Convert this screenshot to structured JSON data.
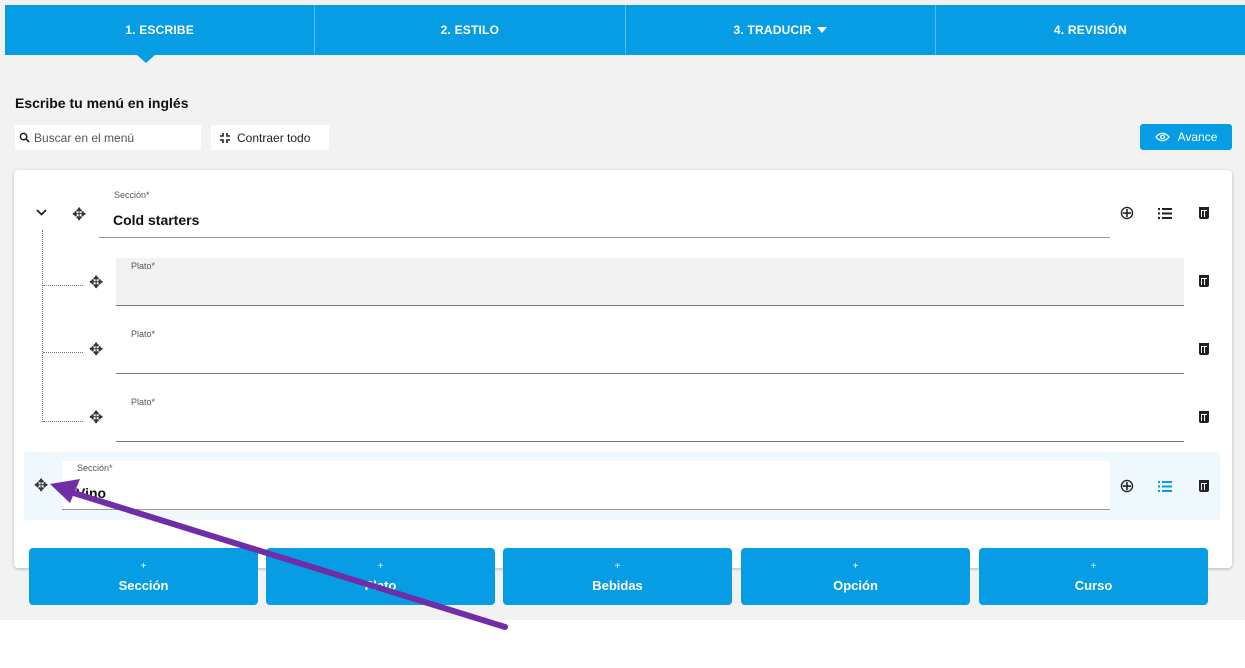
{
  "tabs": [
    {
      "label": "1. ESCRIBE"
    },
    {
      "label": "2. ESTILO"
    },
    {
      "label": "3. TRADUCIR"
    },
    {
      "label": "4. REVISIÓN"
    }
  ],
  "page_title": "Escribe tu menú en inglés",
  "search": {
    "placeholder": "Buscar en el menú"
  },
  "collapse_label": "Contraer todo",
  "preview_label": "Avance",
  "sections": [
    {
      "label": "Sección*",
      "value": "Cold starters",
      "dishes": [
        {
          "label": "Plato*",
          "value": ""
        },
        {
          "label": "Plato*",
          "value": ""
        },
        {
          "label": "Plato*",
          "value": ""
        }
      ]
    },
    {
      "label": "Sección*",
      "value": "Vino",
      "dishes": []
    }
  ],
  "add_buttons": [
    {
      "plus": "+",
      "label": "Sección"
    },
    {
      "plus": "+",
      "label": "Plato"
    },
    {
      "plus": "+",
      "label": "Bebidas"
    },
    {
      "plus": "+",
      "label": "Opción"
    },
    {
      "plus": "+",
      "label": "Curso"
    }
  ],
  "icons": {
    "move": "✥",
    "add_circle": "⊕",
    "list": "≡",
    "search": "🔍",
    "eye": "👁",
    "chevron": "⌄"
  },
  "colors": {
    "accent": "#069de4",
    "annotation_arrow": "#6f2da8",
    "highlight_row": "#eef8fd"
  }
}
